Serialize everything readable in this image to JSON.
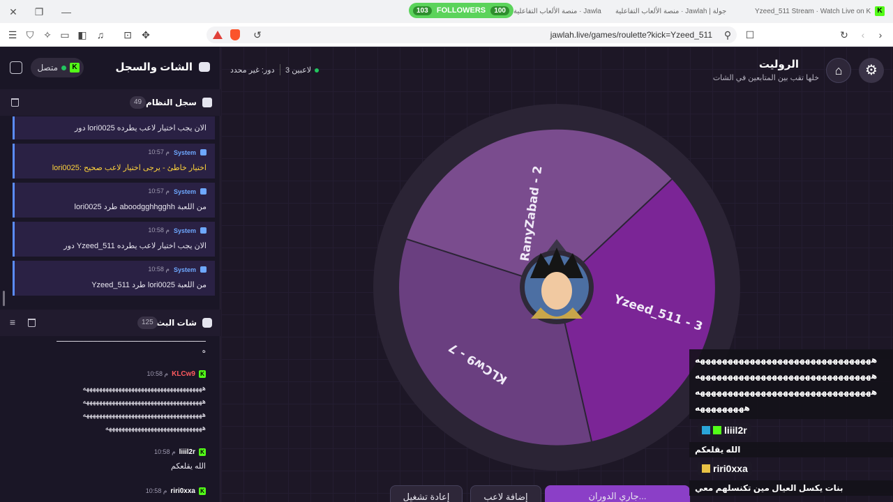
{
  "browser": {
    "tabs": [
      {
        "label": "منصة الألعاب التفاعلية · Jawlah | جولة"
      },
      {
        "label": "منصة الألعاب التفاعلية · Jawlah | جولة"
      },
      {
        "label": "Yzeed_511 Stream · Watch Live on Kick"
      }
    ],
    "followers": {
      "left": "103",
      "label": "FOLLOWERS",
      "right": "100"
    },
    "url": "jawlah.live/games/roulette?kick=Yzeed_511"
  },
  "left_panel": {
    "title": "الشات والسجل",
    "status": "متصل",
    "system_log": {
      "title": "سجل النظام",
      "count": "49",
      "entries": [
        {
          "sender": "",
          "time": "",
          "text": "دور lori0025 الان يجب اختيار لاعب يطرده",
          "warn": false
        },
        {
          "sender": "System",
          "time": "10:57 م",
          "text": "lori0025: اختيار خاطئ - يرجى اختيار لاعب صحيح",
          "warn": true
        },
        {
          "sender": "System",
          "time": "10:57 م",
          "text": "lori0025 طرد aboodgghhgghh من اللعبة",
          "warn": false
        },
        {
          "sender": "System",
          "time": "10:58 م",
          "text": "دور Yzeed_511 الان يجب اختيار لاعب يطرده",
          "warn": false
        },
        {
          "sender": "System",
          "time": "10:58 م",
          "text": "Yzeed_511 طرد lori0025 من اللعبة",
          "warn": false
        }
      ]
    },
    "stream_chat": {
      "title": "شات البث",
      "count": "125",
      "messages": [
        {
          "user": "",
          "time": "",
          "color": "#ffffff",
          "body": "ـــــــــــــــــــــــــــــــــــــــــــــــــــــــــــــــــــــــــ\nه"
        },
        {
          "user": "KLCw9",
          "time": "10:58 م",
          "color": "#ff5a5f",
          "body": "هههههههههههههههههههههههههههههههههههههه\nهههههههههههههههههههههههههههههههههههههه\nهههههههههههههههههههههههههههههههههههههه\nههههههههههههههههههههههههههههههه"
        },
        {
          "user": "liiil2r",
          "time": "10:58 م",
          "color": "#ffffff",
          "body": "الله يقلعكم"
        },
        {
          "user": "riri0xxa",
          "time": "10:58 م",
          "color": "#ffffff",
          "body": ""
        }
      ]
    }
  },
  "main": {
    "title": "الروليت",
    "subtitle": "خلها تقب بين المتابعين في الشات",
    "players": "3 لاعبين",
    "turn": "دور: غير محدد",
    "wheel": {
      "segments": [
        {
          "label": "RanyZabad - 2",
          "color": "#7a4c8e"
        },
        {
          "label": "Yzeed_511 - 3",
          "color": "#7b2596"
        },
        {
          "label": "KLCw9 - 7",
          "color": "#6a3f80"
        }
      ]
    },
    "buttons": {
      "spinning": "جاري الدوران...",
      "add_player": "إضافة لاعب",
      "restart": "إعادة تشغيل"
    }
  },
  "overlay_chat": {
    "lines": [
      "ههههههههههههههههههههههههههههههههه",
      "ههههههههههههههههههههههههههههههههه",
      "ههههههههههههههههههههههههههههههههه",
      "هههههههههه"
    ],
    "user1": "liiil2r",
    "msg1": "الله يقلعكم",
    "user2": "riri0xxa",
    "msg2": "بنات يكسل العيال مين تكنسلهم معي"
  }
}
